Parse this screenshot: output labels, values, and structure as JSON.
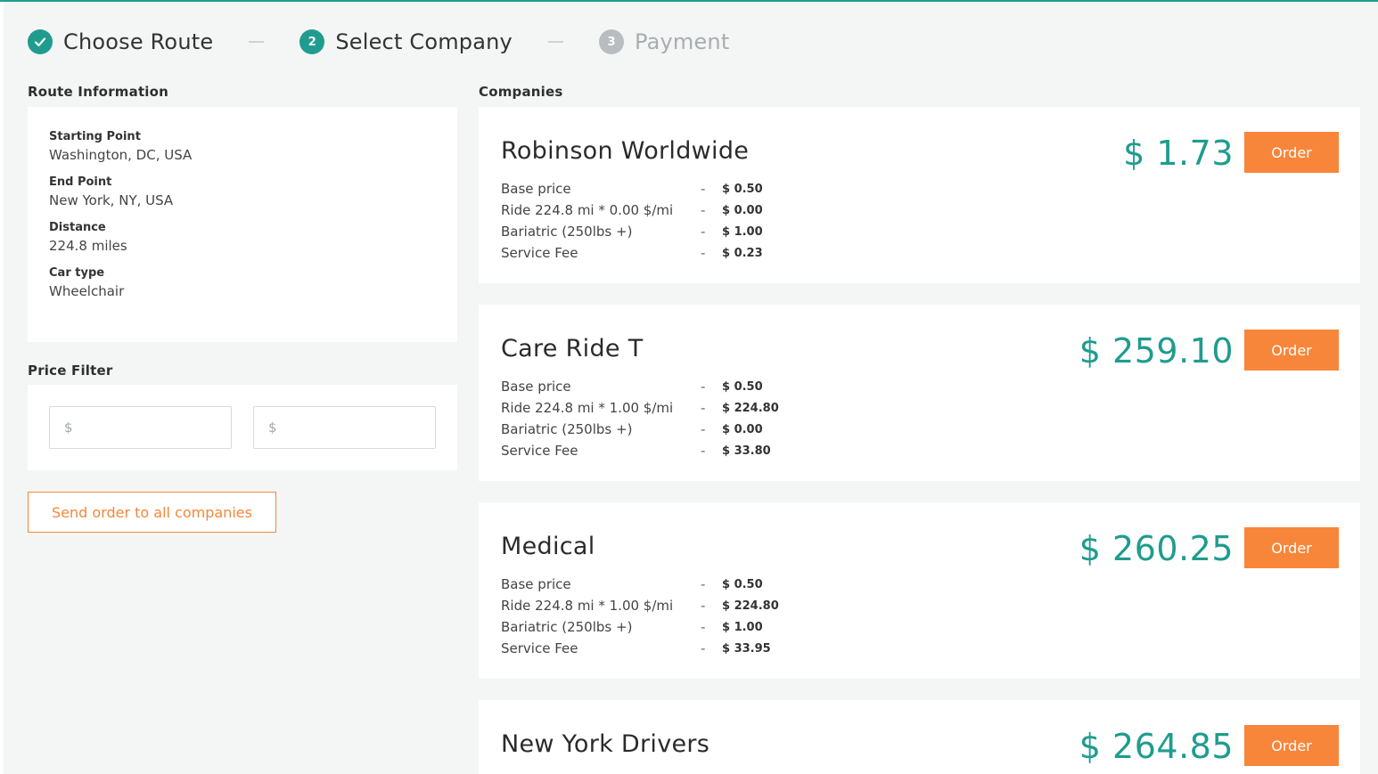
{
  "stepper": {
    "steps": [
      {
        "label": "Choose Route",
        "state": "done",
        "marker": "✓"
      },
      {
        "label": "Select Company",
        "state": "active",
        "marker": "2"
      },
      {
        "label": "Payment",
        "state": "todo",
        "marker": "3"
      }
    ]
  },
  "route": {
    "title": "Route Information",
    "items": [
      {
        "key": "Starting Point",
        "value": "Washington, DC, USA"
      },
      {
        "key": "End Point",
        "value": "New York, NY, USA"
      },
      {
        "key": "Distance",
        "value": "224.8 miles"
      },
      {
        "key": "Car type",
        "value": "Wheelchair"
      }
    ]
  },
  "filter": {
    "title": "Price Filter",
    "min_placeholder": "$",
    "max_placeholder": "$"
  },
  "send_all_label": "Send order to all companies",
  "companies_title": "Companies",
  "companies": [
    {
      "name": "Robinson Worldwide",
      "total": "$ 1.73",
      "order_label": "Order",
      "rows": [
        {
          "label": "Base price",
          "sep": "-",
          "value": "$ 0.50"
        },
        {
          "label": "Ride 224.8 mi * 0.00 $/mi",
          "sep": "-",
          "value": "$ 0.00"
        },
        {
          "label": "Bariatric (250lbs +)",
          "sep": "-",
          "value": "$ 1.00"
        },
        {
          "label": "Service Fee",
          "sep": "-",
          "value": "$ 0.23"
        }
      ]
    },
    {
      "name": "Care Ride T",
      "total": "$ 259.10",
      "order_label": "Order",
      "rows": [
        {
          "label": "Base price",
          "sep": "-",
          "value": "$ 0.50"
        },
        {
          "label": "Ride 224.8 mi * 1.00 $/mi",
          "sep": "-",
          "value": "$ 224.80"
        },
        {
          "label": "Bariatric (250lbs +)",
          "sep": "-",
          "value": "$ 0.00"
        },
        {
          "label": "Service Fee",
          "sep": "-",
          "value": "$ 33.80"
        }
      ]
    },
    {
      "name": "Medical",
      "total": "$ 260.25",
      "order_label": "Order",
      "rows": [
        {
          "label": "Base price",
          "sep": "-",
          "value": "$ 0.50"
        },
        {
          "label": "Ride 224.8 mi * 1.00 $/mi",
          "sep": "-",
          "value": "$ 224.80"
        },
        {
          "label": "Bariatric (250lbs +)",
          "sep": "-",
          "value": "$ 1.00"
        },
        {
          "label": "Service Fee",
          "sep": "-",
          "value": "$ 33.95"
        }
      ]
    },
    {
      "name": "New York Drivers",
      "total": "$ 264.85",
      "order_label": "Order",
      "rows": []
    }
  ],
  "colors": {
    "accent": "#1f9c8e",
    "order": "#f7863a",
    "muted": "#b9bdc0"
  }
}
